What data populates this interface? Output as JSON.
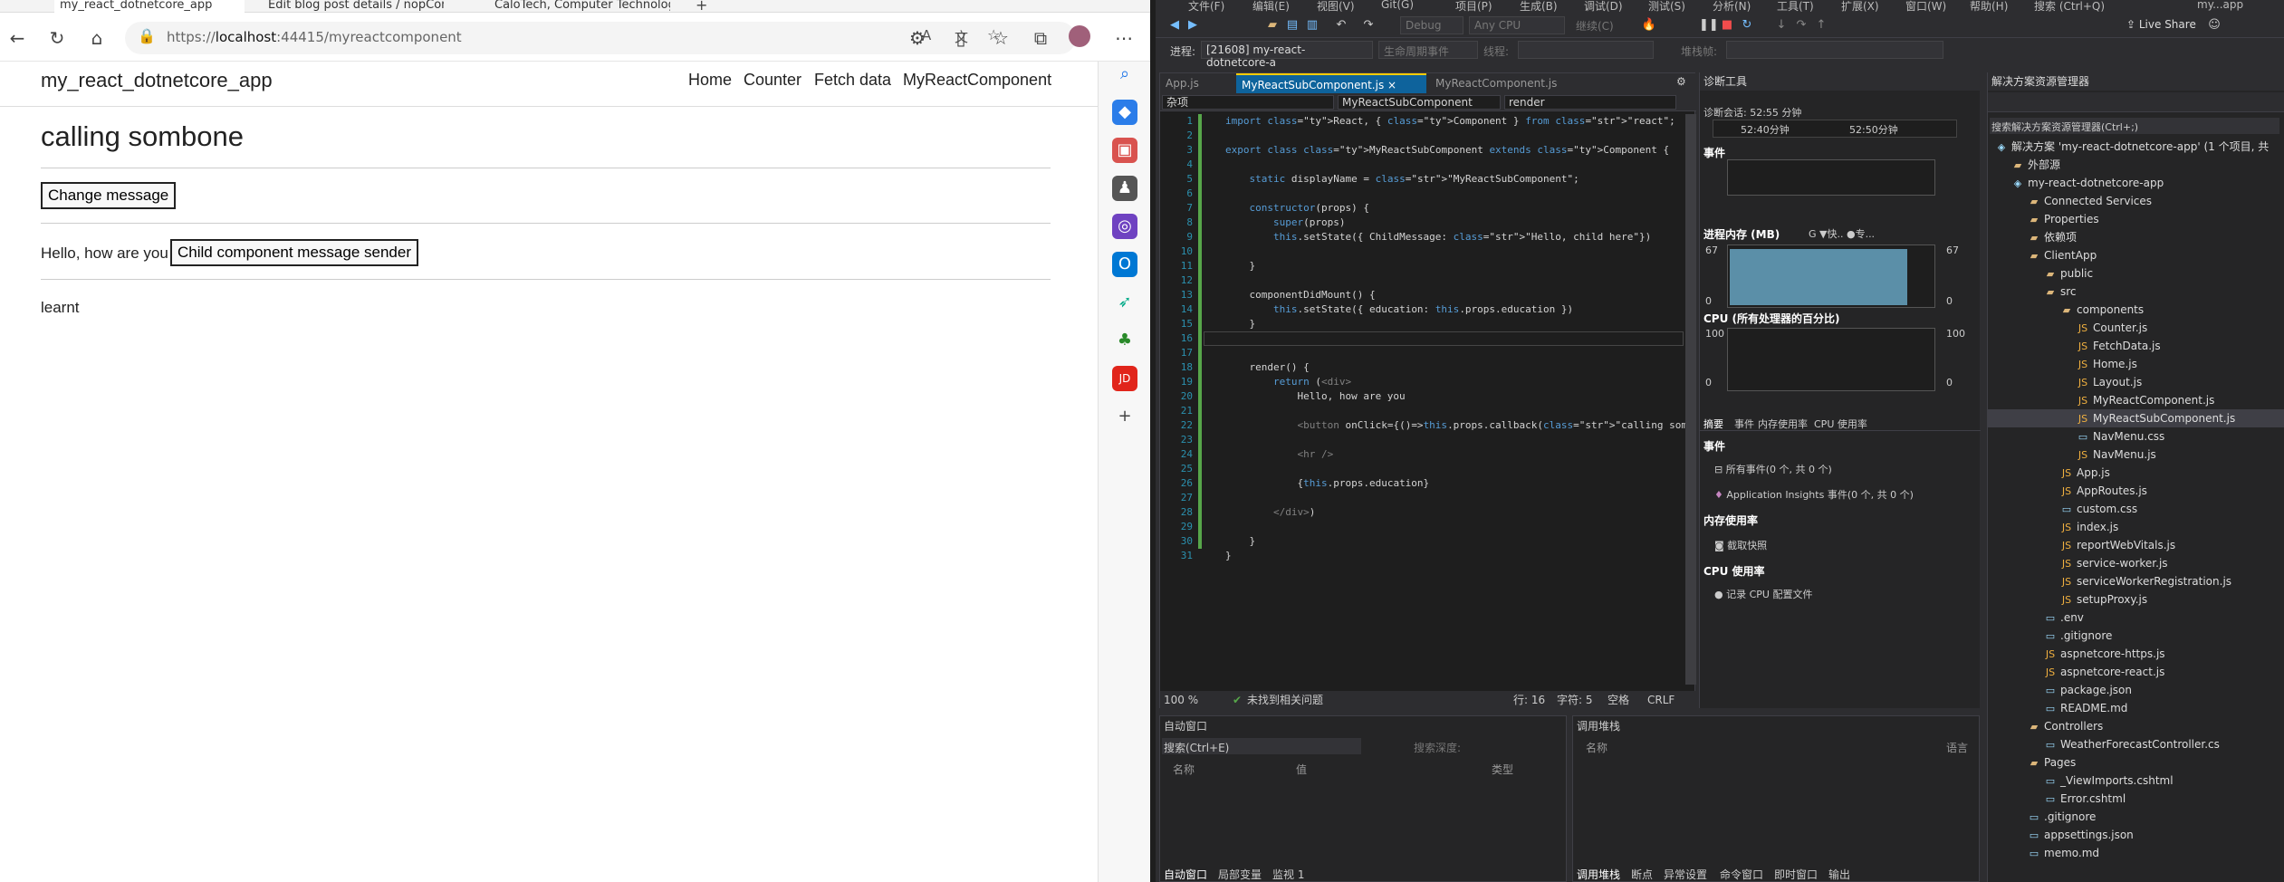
{
  "browser": {
    "tabs": [
      "my_react_dotnetcore_app",
      "Edit blog post details / nopComm",
      "CaloTech, Computer Technologie"
    ],
    "url_prefix": "https://",
    "url_host": "localhost",
    "url_rest": ":44415/myreactcomponent"
  },
  "page": {
    "brand": "my_react_dotnetcore_app",
    "nav": [
      "Home",
      "Counter",
      "Fetch data",
      "MyReactComponent"
    ],
    "heading": "calling sombone",
    "change_button": "Change message",
    "hello": "Hello, how are you",
    "child_button": "Child component message sender",
    "education": "learnt"
  },
  "vs": {
    "menu": [
      "文件(F)",
      "编辑(E)",
      "视图(V)",
      "Git(G)",
      "项目(P)",
      "生成(B)",
      "调试(D)",
      "测试(S)",
      "分析(N)",
      "工具(T)",
      "扩展(X)",
      "窗口(W)",
      "帮助(H)",
      "搜索 (Ctrl+Q)",
      "my...app"
    ],
    "config": "Debug",
    "cpu": "Any CPU",
    "continue": "继续(C)",
    "liveshare": "Live Share",
    "process_label": "进程:",
    "process": "[21608] my-react-dotnetcore-a",
    "lifecycle": "生命周期事件",
    "thread": "线程:",
    "stackframe": "堆栈帧:",
    "editor_tabs": [
      "App.js",
      "MyReactSubComponent.js",
      "MyReactComponent.js"
    ],
    "nav_combos": [
      "杂项",
      "MyReactSubComponent",
      "render"
    ],
    "code": [
      "import React, { Component } from \"react\";",
      "",
      "export class MyReactSubComponent extends Component {",
      "",
      "    static displayName = \"MyReactSubComponent\";",
      "",
      "    constructor(props) {",
      "        super(props)",
      "        this.setState({ ChildMessage: \"Hello, child here\"})",
      "",
      "    }",
      "",
      "    componentDidMount() {",
      "        this.setState({ education: this.props.education })",
      "    }",
      "",
      "",
      "    render() {",
      "        return (<div>",
      "            Hello, how are you",
      "",
      "            <button onClick={()=>this.props.callback(\"calling sombone\")",
      "",
      "            <hr />",
      "",
      "            {this.props.education}",
      "",
      "        </div>)",
      "",
      "    }",
      "}"
    ],
    "zoom": "100 %",
    "issues": "未找到相关问题",
    "line": "行: 16",
    "col": "字符: 5",
    "spaces": "空格",
    "eol": "CRLF",
    "diag": {
      "title": "诊断工具",
      "session": "诊断会话: 52:55 分钟",
      "t1": "52:40分钟",
      "t2": "52:50分钟",
      "events": "事件",
      "memory": "进程内存 (MB)",
      "mem_legend": "G  ▼快..  ●专...",
      "mem_max": "67",
      "mem_min": "0",
      "cpu": "CPU (所有处理器的百分比)",
      "cpu_max": "100",
      "cpu_min": "0",
      "tabs": [
        "摘要",
        "事件",
        "内存使用率",
        "CPU 使用率"
      ],
      "ev_h": "事件",
      "ev1": "所有事件(0 个, 共 0 个)",
      "ev2": "Application Insights 事件(0 个, 共 0 个)",
      "mem_h": "内存使用率",
      "mem1": "截取快照",
      "cpu_h": "CPU 使用率",
      "cpu1": "记录 CPU 配置文件"
    },
    "sol_title": "解决方案资源管理器",
    "sol_search": "搜索解决方案资源管理器(Ctrl+;)",
    "tree": [
      "解决方案 'my-react-dotnetcore-app' (1 个项目, 共",
      "外部源",
      "my-react-dotnetcore-app",
      "Connected Services",
      "Properties",
      "依赖项",
      "ClientApp",
      "public",
      "src",
      "components",
      "Counter.js",
      "FetchData.js",
      "Home.js",
      "Layout.js",
      "MyReactComponent.js",
      "MyReactSubComponent.js",
      "NavMenu.css",
      "NavMenu.js",
      "App.js",
      "AppRoutes.js",
      "custom.css",
      "index.js",
      "reportWebVitals.js",
      "service-worker.js",
      "serviceWorkerRegistration.js",
      "setupProxy.js",
      ".env",
      ".gitignore",
      "aspnetcore-https.js",
      "aspnetcore-react.js",
      "package.json",
      "README.md",
      "Controllers",
      "WeatherForecastController.cs",
      "Pages",
      "_ViewImports.cshtml",
      "Error.cshtml",
      ".gitignore",
      "appsettings.json",
      "memo.md"
    ],
    "autos": {
      "title": "自动窗口",
      "search": "搜索(Ctrl+E)",
      "depth": "搜索深度:",
      "cols": [
        "名称",
        "值",
        "类型"
      ],
      "tabs": [
        "自动窗口",
        "局部变量",
        "监视 1"
      ]
    },
    "callstack": {
      "title": "调用堆栈",
      "cols": [
        "名称",
        "语言"
      ],
      "tabs": [
        "调用堆栈",
        "断点",
        "异常设置",
        "命令窗口",
        "即时窗口",
        "输出"
      ]
    }
  }
}
